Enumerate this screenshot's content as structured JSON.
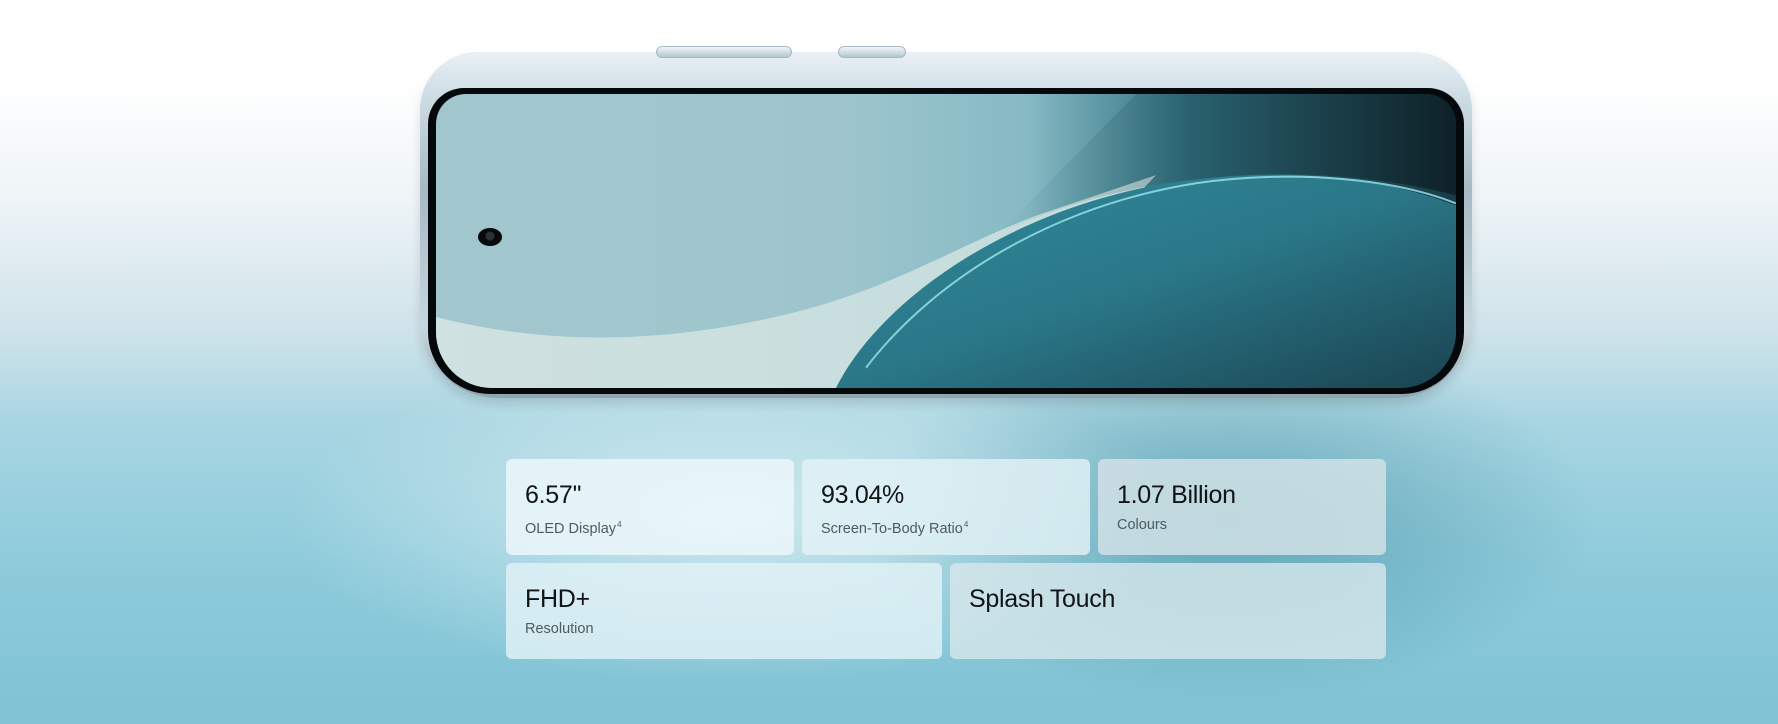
{
  "colors": {
    "card_background": "#eef8fb",
    "text_primary": "#111416",
    "text_secondary": "#4e5a60",
    "accent_teal": "#2e6f7e"
  },
  "specs": [
    {
      "value": "6.57''",
      "label": "OLED Display",
      "footnote": "4"
    },
    {
      "value": "93.04%",
      "label": "Screen-To-Body Ratio",
      "footnote": "4"
    },
    {
      "value": "1.07 Billion",
      "label": "Colours",
      "footnote": ""
    },
    {
      "value": "FHD+",
      "label": "Resolution",
      "footnote": ""
    },
    {
      "value": "Splash Touch",
      "label": "",
      "footnote": ""
    }
  ]
}
